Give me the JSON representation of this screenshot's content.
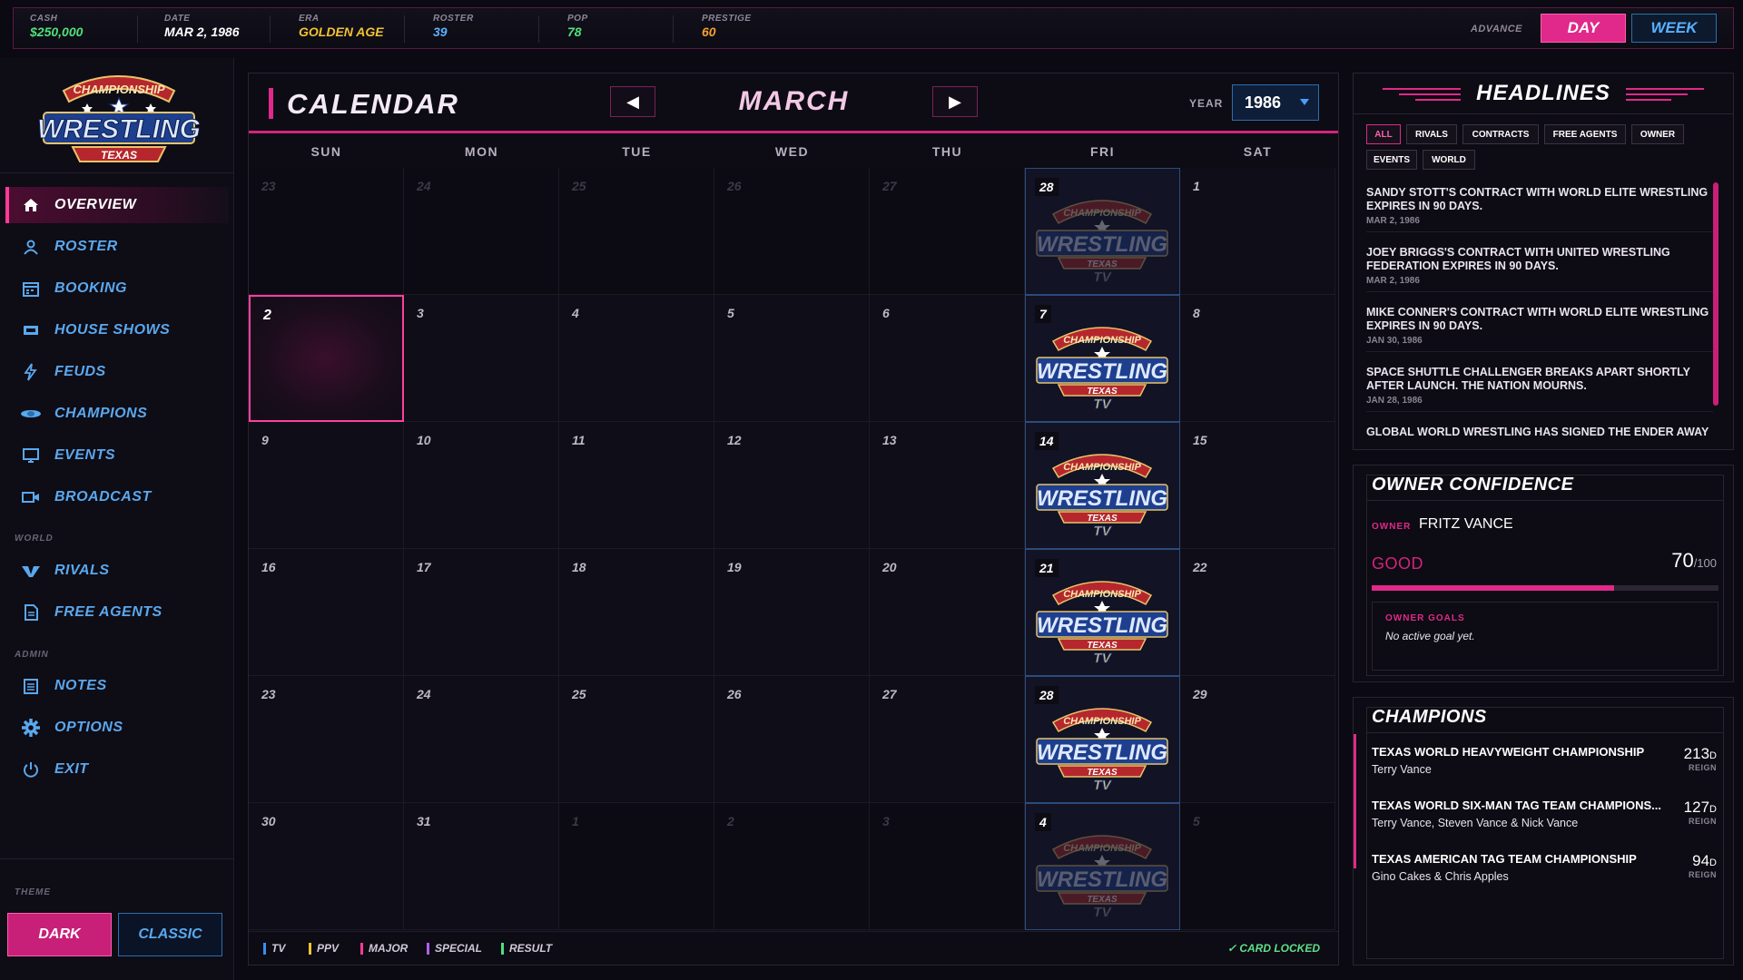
{
  "topbar": {
    "stats": [
      {
        "label": "CASH",
        "value": "$250,000",
        "color": "#4fe07a"
      },
      {
        "label": "DATE",
        "value": "MAR 2, 1986",
        "color": "#ffffff"
      },
      {
        "label": "ERA",
        "value": "GOLDEN AGE",
        "color": "#f2c230"
      },
      {
        "label": "ROSTER",
        "value": "39",
        "color": "#5ab0ff"
      },
      {
        "label": "POP",
        "value": "78",
        "color": "#4fe07a"
      },
      {
        "label": "PRESTIGE",
        "value": "60",
        "color": "#f2a030"
      }
    ],
    "advance_label": "ADVANCE",
    "day_button": "DAY",
    "week_button": "WEEK"
  },
  "sidebar": {
    "logo_alt": "CHAMPIONSHIP WRESTLING FROM TEXAS",
    "items": [
      {
        "label": "OVERVIEW",
        "icon": "home-icon",
        "active": true
      },
      {
        "label": "ROSTER",
        "icon": "person-icon"
      },
      {
        "label": "BOOKING",
        "icon": "calendar-icon"
      },
      {
        "label": "HOUSE SHOWS",
        "icon": "ticket-icon"
      },
      {
        "label": "FEUDS",
        "icon": "lightning-icon"
      },
      {
        "label": "CHAMPIONS",
        "icon": "belt-icon"
      },
      {
        "label": "EVENTS",
        "icon": "monitor-icon"
      },
      {
        "label": "BROADCAST",
        "icon": "camera-icon"
      },
      {
        "label": "RIVALS",
        "icon": "rivals-icon"
      },
      {
        "label": "FREE AGENTS",
        "icon": "document-icon"
      },
      {
        "label": "NOTES",
        "icon": "notepad-icon"
      },
      {
        "label": "OPTIONS",
        "icon": "gear-icon"
      },
      {
        "label": "EXIT",
        "icon": "power-icon"
      }
    ],
    "section_world": "WORLD",
    "section_admin": "ADMIN",
    "theme_label": "THEME",
    "theme_dark": "DARK",
    "theme_classic": "CLASSIC"
  },
  "calendar": {
    "title": "CALENDAR",
    "month": "MARCH",
    "year_label": "YEAR",
    "year": "1986",
    "weekdays": [
      "SUN",
      "MON",
      "TUE",
      "WED",
      "THU",
      "FRI",
      "SAT"
    ],
    "weeks": [
      [
        "23",
        "24",
        "25",
        "26",
        "27",
        "28",
        "1"
      ],
      [
        "2",
        "3",
        "4",
        "5",
        "6",
        "7",
        "8"
      ],
      [
        "9",
        "10",
        "11",
        "12",
        "13",
        "14",
        "15"
      ],
      [
        "16",
        "17",
        "18",
        "19",
        "20",
        "21",
        "22"
      ],
      [
        "23",
        "24",
        "25",
        "26",
        "27",
        "28",
        "29"
      ],
      [
        "30",
        "31",
        "1",
        "2",
        "3",
        "4",
        "5"
      ]
    ],
    "other_month": [
      [
        true,
        true,
        true,
        true,
        true,
        true,
        false
      ],
      [
        false,
        false,
        false,
        false,
        false,
        false,
        false
      ],
      [
        false,
        false,
        false,
        false,
        false,
        false,
        false
      ],
      [
        false,
        false,
        false,
        false,
        false,
        false,
        false
      ],
      [
        false,
        false,
        false,
        false,
        false,
        false,
        false
      ],
      [
        false,
        false,
        true,
        true,
        true,
        true,
        true
      ]
    ],
    "today": "2",
    "tv_logo_text": {
      "top": "CHAMPIONSHIP",
      "middle": "WRESTLING",
      "bottom": "TEXAS",
      "tv": "TV"
    },
    "legend": [
      {
        "label": "TV",
        "color": "#3a8ff0"
      },
      {
        "label": "PPV",
        "color": "#f2c230"
      },
      {
        "label": "MAJOR",
        "color": "#ff3a9a"
      },
      {
        "label": "SPECIAL",
        "color": "#b060f0"
      },
      {
        "label": "RESULT",
        "color": "#4fe07a"
      }
    ],
    "card_locked": "✓ CARD LOCKED"
  },
  "headlines": {
    "title": "HEADLINES",
    "filters": [
      "ALL",
      "RIVALS",
      "CONTRACTS",
      "FREE AGENTS",
      "OWNER",
      "EVENTS",
      "WORLD"
    ],
    "active_filter": "ALL",
    "items": [
      {
        "text": "SANDY STOTT'S CONTRACT WITH WORLD ELITE WRESTLING EXPIRES IN 90 DAYS.",
        "date": "MAR 2, 1986"
      },
      {
        "text": "JOEY BRIGGS'S CONTRACT WITH UNITED WRESTLING FEDERATION EXPIRES IN 90 DAYS.",
        "date": "MAR 2, 1986"
      },
      {
        "text": "MIKE CONNER'S CONTRACT WITH WORLD ELITE WRESTLING EXPIRES IN 90 DAYS.",
        "date": "JAN 30, 1986"
      },
      {
        "text": "SPACE SHUTTLE CHALLENGER BREAKS APART SHORTLY AFTER LAUNCH. THE NATION MOURNS.",
        "date": "JAN 28, 1986"
      },
      {
        "text": "GLOBAL WORLD WRESTLING HAS SIGNED THE ENDER AWAY",
        "date": ""
      }
    ]
  },
  "owner_confidence": {
    "title": "OWNER CONFIDENCE",
    "owner_label": "OWNER",
    "owner_name": "FRITZ VANCE",
    "level": "GOOD",
    "score": "70",
    "max": "/100",
    "fill_fraction": 0.7,
    "goals_label": "OWNER GOALS",
    "goals_text": "No active goal yet."
  },
  "champions": {
    "title": "CHAMPIONS",
    "items": [
      {
        "title": "TEXAS WORLD HEAVYWEIGHT CHAMPIONSHIP",
        "holder": "Terry Vance",
        "days": "213",
        "unit": "D",
        "reign": "REIGN"
      },
      {
        "title": "TEXAS WORLD SIX-MAN TAG TEAM CHAMPIONS...",
        "holder": "Terry Vance, Steven Vance & Nick Vance",
        "days": "127",
        "unit": "D",
        "reign": "REIGN"
      },
      {
        "title": "TEXAS AMERICAN TAG TEAM CHAMPIONSHIP",
        "holder": "Gino Cakes & Chris Apples",
        "days": "94",
        "unit": "D",
        "reign": "REIGN"
      }
    ]
  }
}
